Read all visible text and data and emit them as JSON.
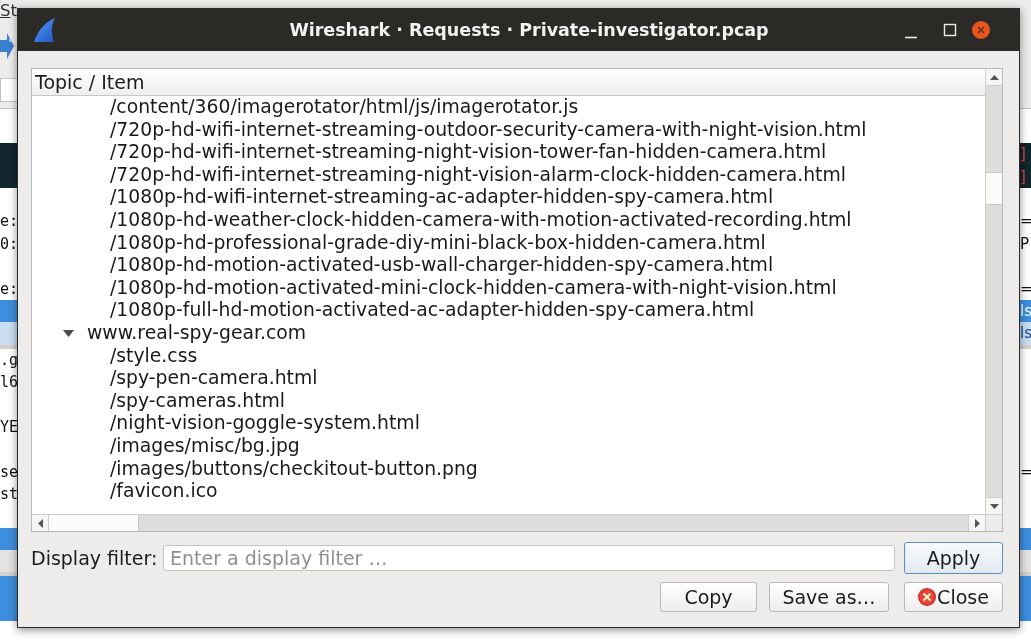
{
  "background_window": {
    "menu": [
      "St"
    ],
    "rows": [
      {
        "kind": "dark",
        "right": "]"
      },
      {
        "kind": "dark",
        "right": "]"
      },
      {
        "kind": "plain"
      },
      {
        "kind": "plain",
        "left": "e:",
        "right": "="
      },
      {
        "kind": "plain",
        "left": "0:",
        "right": "P"
      },
      {
        "kind": "plain"
      },
      {
        "kind": "plain",
        "left": "e:",
        "right": "="
      },
      {
        "kind": "selected",
        "right": "ls"
      },
      {
        "kind": "selected_light",
        "right": "ls"
      },
      {
        "kind": "splitter"
      },
      {
        "kind": "plain",
        "left": ".g"
      },
      {
        "kind": "plain",
        "left": "l6"
      },
      {
        "kind": "plain"
      },
      {
        "kind": "plain",
        "left": "YE"
      },
      {
        "kind": "plain"
      },
      {
        "kind": "plain",
        "left": "se",
        "right": "="
      },
      {
        "kind": "plain",
        "left": "st"
      },
      {
        "kind": "plain"
      },
      {
        "kind": "selected"
      },
      {
        "kind": "muted"
      },
      {
        "kind": "splitter"
      },
      {
        "kind": "selected"
      },
      {
        "kind": "selected"
      },
      {
        "kind": "bytes"
      }
    ]
  },
  "window": {
    "title": "Wireshark · Requests · Private-investigator.pcap"
  },
  "tree": {
    "header": "Topic / Item",
    "hosts": [
      {
        "children": [
          "/content/360/imagerotator/html/js/imagerotator.js",
          "/720p-hd-wifi-internet-streaming-outdoor-security-camera-with-night-vision.html",
          "/720p-hd-wifi-internet-streaming-night-vision-tower-fan-hidden-camera.html",
          "/720p-hd-wifi-internet-streaming-night-vision-alarm-clock-hidden-camera.html",
          "/1080p-hd-wifi-internet-streaming-ac-adapter-hidden-spy-camera.html",
          "/1080p-hd-weather-clock-hidden-camera-with-motion-activated-recording.html",
          "/1080p-hd-professional-grade-diy-mini-black-box-hidden-camera.html",
          "/1080p-hd-motion-activated-usb-wall-charger-hidden-spy-camera.html",
          "/1080p-hd-motion-activated-mini-clock-hidden-camera-with-night-vision.html",
          "/1080p-full-hd-motion-activated-ac-adapter-hidden-spy-camera.html"
        ]
      },
      {
        "label": "www.real-spy-gear.com",
        "expanded": true,
        "children": [
          "/style.css",
          "/spy-pen-camera.html",
          "/spy-cameras.html",
          "/night-vision-goggle-system.html",
          "/images/misc/bg.jpg",
          "/images/buttons/checkitout-button.png",
          "/favicon.ico"
        ]
      }
    ]
  },
  "display_filter": {
    "label": "Display filter:",
    "placeholder": "Enter a display filter …",
    "apply": {
      "label": "Apply",
      "default": true
    }
  },
  "buttons": [
    {
      "label": "Copy",
      "kind": "plain"
    },
    {
      "label": "Save as…",
      "kind": "plain"
    },
    {
      "label": "Close",
      "kind": "close"
    }
  ]
}
